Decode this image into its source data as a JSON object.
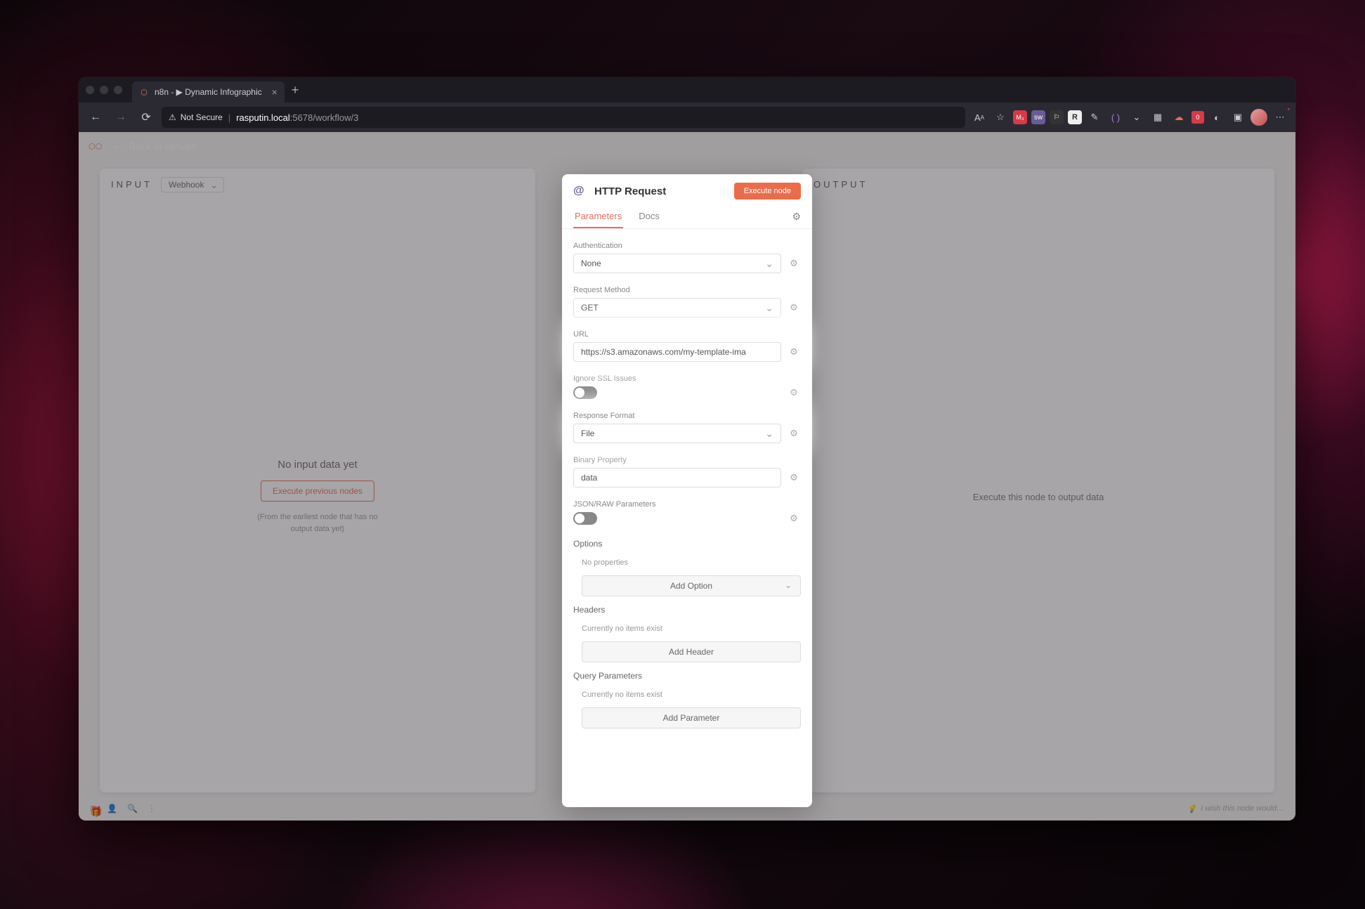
{
  "browser": {
    "tab_title": "n8n - ▶ Dynamic Infographic",
    "not_secure": "Not Secure",
    "url_host": "rasputin.local",
    "url_path": ":5678/workflow/3"
  },
  "app": {
    "back": "Back to canvas",
    "wish": "I wish this node would…"
  },
  "input_panel": {
    "title": "INPUT",
    "source": "Webhook",
    "empty": "No input data yet",
    "exec_prev": "Execute previous nodes",
    "hint": "(From the earliest node that has no output data yet)"
  },
  "output_panel": {
    "title": "OUTPUT",
    "empty": "Execute this node to output data"
  },
  "modal": {
    "title": "HTTP Request",
    "execute": "Execute node",
    "tabs": {
      "params": "Parameters",
      "docs": "Docs"
    },
    "params": {
      "auth_label": "Authentication",
      "auth_value": "None",
      "method_label": "Request Method",
      "method_value": "GET",
      "url_label": "URL",
      "url_value": "https://s3.amazonaws.com/my-template-ima",
      "ssl_label": "Ignore SSL Issues",
      "respfmt_label": "Response Format",
      "respfmt_value": "File",
      "binprop_label": "Binary Property",
      "binprop_value": "data",
      "jsonraw_label": "JSON/RAW Parameters",
      "options_title": "Options",
      "no_props": "No properties",
      "add_option": "Add Option",
      "headers_title": "Headers",
      "no_items": "Currently no items exist",
      "add_header": "Add Header",
      "query_title": "Query Parameters",
      "add_param": "Add Parameter"
    }
  }
}
